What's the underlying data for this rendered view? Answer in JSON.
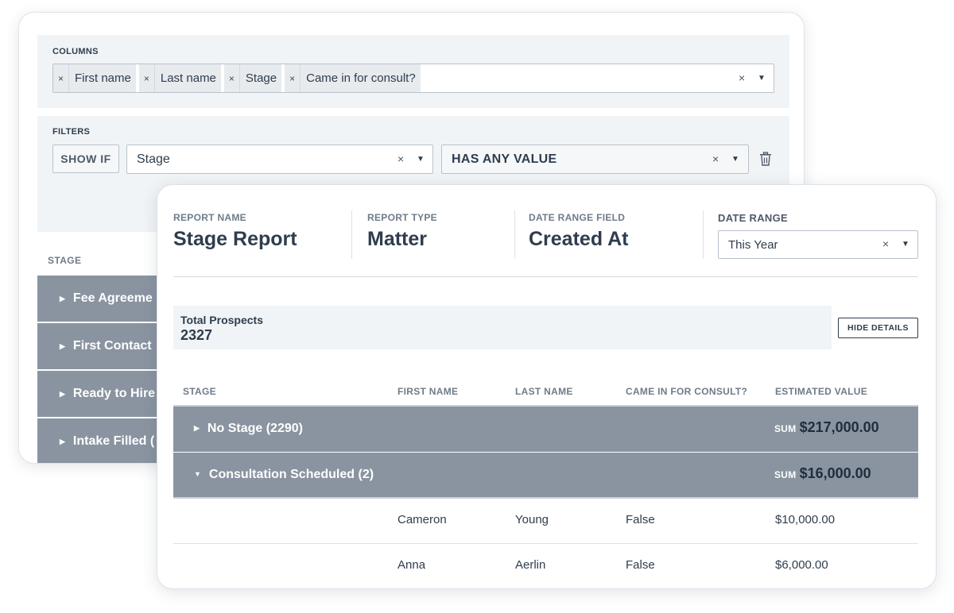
{
  "builder": {
    "columns_label": "COLUMNS",
    "columns": [
      "First name",
      "Last name",
      "Stage",
      "Came in for consult?"
    ],
    "tag_remove_icon": "×",
    "clear_icon": "×",
    "filters_label": "FILTERS",
    "show_if_label": "SHOW IF",
    "filter_field": "Stage",
    "filter_condition": "HAS ANY VALUE",
    "stage_column_label": "STAGE",
    "stage_rows": [
      "Fee Agreeme",
      "First Contact",
      "Ready to Hire",
      "Intake Filled ("
    ]
  },
  "report": {
    "name_label": "REPORT NAME",
    "name": "Stage Report",
    "type_label": "REPORT TYPE",
    "type": "Matter",
    "date_field_label": "DATE RANGE FIELD",
    "date_field": "Created At",
    "date_range_label": "DATE RANGE",
    "date_range": "This Year",
    "total_label": "Total Prospects",
    "total_value": "2327",
    "hide_details_label": "HIDE DETAILS",
    "headers": [
      "STAGE",
      "FIRST NAME",
      "LAST NAME",
      "CAME IN FOR CONSULT?",
      "ESTIMATED VALUE"
    ],
    "sum_label": "SUM",
    "groups": [
      {
        "title": "No Stage (2290)",
        "sum": "$217,000.00",
        "expanded": false
      },
      {
        "title": "Consultation Scheduled (2)",
        "sum": "$16,000.00",
        "expanded": true
      }
    ],
    "rows": [
      {
        "first": "Cameron",
        "last": "Young",
        "consult": "False",
        "value": "$10,000.00"
      },
      {
        "first": "Anna",
        "last": "Aerlin",
        "consult": "False",
        "value": "$6,000.00"
      }
    ]
  },
  "icons": {
    "caret": "▼",
    "tri_right": "▶",
    "tri_down": "▼",
    "trash": "trash-icon"
  }
}
